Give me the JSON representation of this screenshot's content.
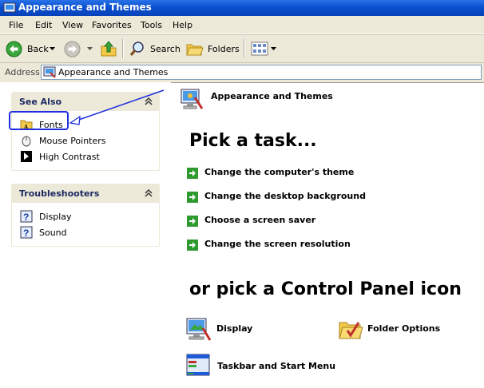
{
  "window": {
    "title": "Appearance and Themes"
  },
  "menu": {
    "items": [
      "File",
      "Edit",
      "View",
      "Favorites",
      "Tools",
      "Help"
    ]
  },
  "toolbar": {
    "back_label": "Back",
    "search_label": "Search",
    "folders_label": "Folders"
  },
  "address": {
    "label": "Address",
    "value": "Appearance and Themes"
  },
  "see_also": {
    "title": "See Also",
    "items": [
      {
        "label": "Fonts"
      },
      {
        "label": "Mouse Pointers"
      },
      {
        "label": "High Contrast"
      }
    ]
  },
  "troubleshooters": {
    "title": "Troubleshooters",
    "items": [
      {
        "label": "Display"
      },
      {
        "label": "Sound"
      }
    ]
  },
  "main": {
    "category_title": "Appearance and Themes",
    "pick_task_heading": "Pick a task...",
    "tasks": [
      {
        "label": "Change the computer's theme"
      },
      {
        "label": "Change the desktop background"
      },
      {
        "label": "Choose a screen saver"
      },
      {
        "label": "Change the screen resolution"
      }
    ],
    "pick_icon_heading": "or pick a Control Panel icon",
    "icons": [
      {
        "label": "Display",
        "icon": "display-icon"
      },
      {
        "label": "Folder Options",
        "icon": "folder-options-icon"
      },
      {
        "label": "Taskbar and Start Menu",
        "icon": "taskbar-icon"
      }
    ]
  },
  "colors": {
    "title_bar": "#0a50d0",
    "annotation": "#1f2ee0",
    "task_arrow": "#2e9a2e",
    "heading_text": "#000000"
  }
}
